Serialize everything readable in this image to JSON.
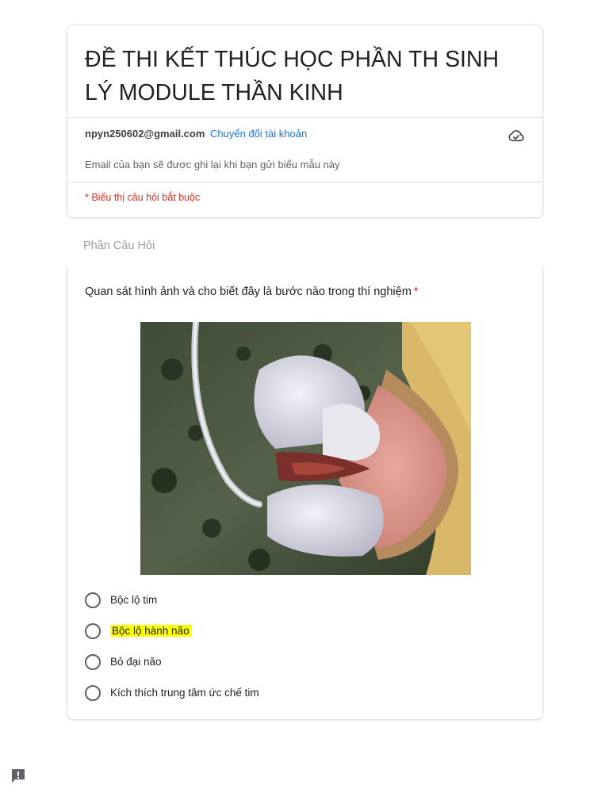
{
  "form": {
    "title": "ĐỀ THI KẾT THÚC HỌC PHẦN TH SINH LÝ MODULE THẦN KINH",
    "account_email": "npyn250602@gmail.com",
    "switch_account_label": "Chuyển đổi tài khoản",
    "email_note": "Email của bạn sẽ được ghi lại khi bạn gửi biểu mẫu này",
    "required_note": "* Biểu thị câu hỏi bắt buộc"
  },
  "section": {
    "title": "Phần Câu Hỏi"
  },
  "question": {
    "text": "Quan sát hình ảnh và cho biết đây là bước nào trong thí nghiệm",
    "required_marker": "*",
    "options": [
      {
        "label": "Bộc lộ tim",
        "highlighted": false
      },
      {
        "label": "Bộc lộ hành não",
        "highlighted": true
      },
      {
        "label": "Bỏ đại não",
        "highlighted": false
      },
      {
        "label": "Kích thích trung tâm ức chế tim",
        "highlighted": false
      }
    ]
  },
  "icons": {
    "cloud": "cloud-icon",
    "report": "report-icon"
  },
  "colors": {
    "link": "#1a73e8",
    "required": "#d93025",
    "highlight": "#ffff00"
  }
}
